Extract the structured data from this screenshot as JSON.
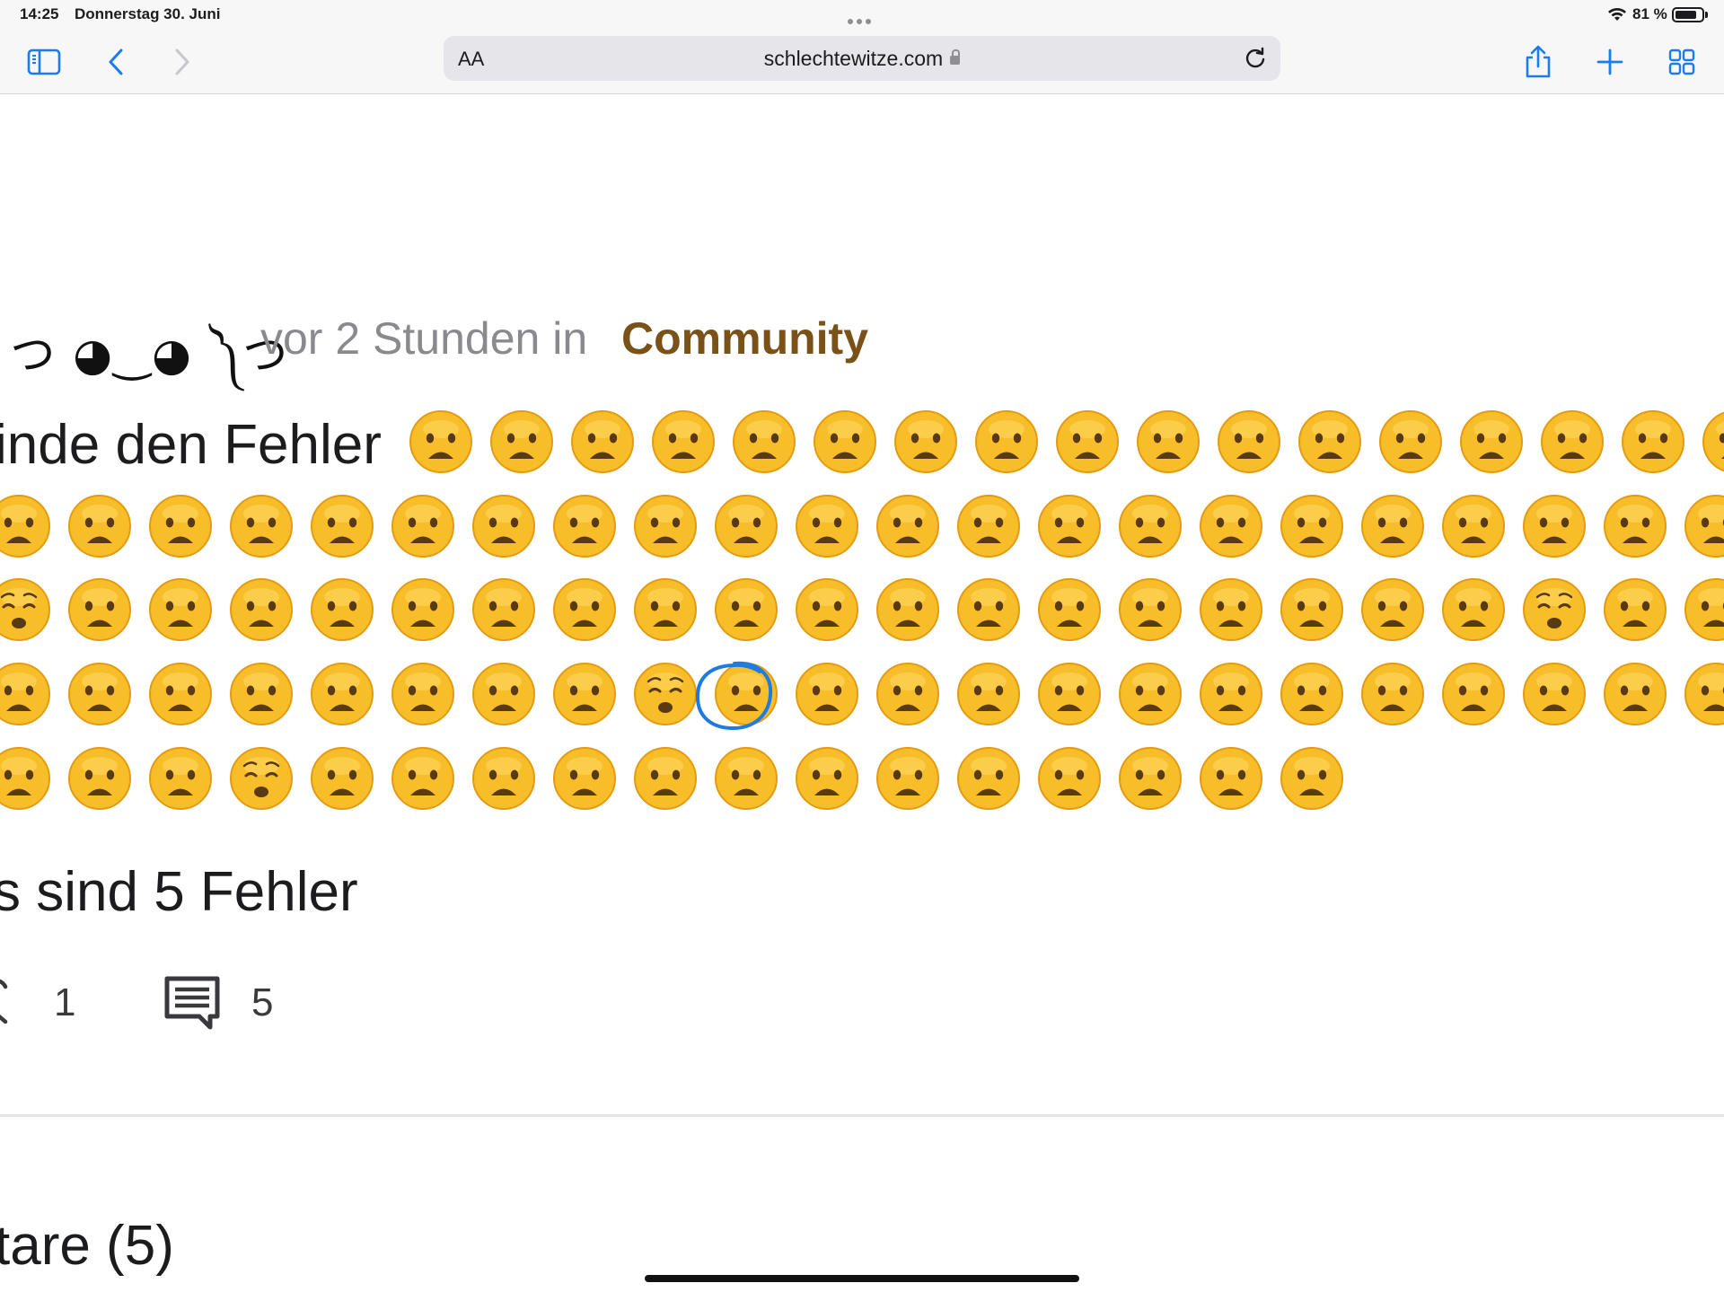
{
  "status_bar": {
    "time": "14:25",
    "date": "Donnerstag 30. Juni",
    "battery_percent": "81 %",
    "battery_level": 0.81
  },
  "toolbar": {
    "reader_label": "AA",
    "url": "schlechtewitze.com",
    "icons": [
      "sidebar-icon",
      "back-icon",
      "forward-icon",
      "reload-icon",
      "share-icon",
      "plus-icon",
      "tabs-grid-icon"
    ]
  },
  "post": {
    "author": "ʖ̯ つ ◕‿◕ ༽つ",
    "time": "vor 2 Stunden in",
    "category": "Community",
    "title": "inde den Fehler",
    "answer": "s sind 5 Fehler",
    "likes": "1",
    "comments": "5"
  },
  "comments_section": {
    "heading": "tare (5)"
  },
  "emoji_puzzle": {
    "rows": 5,
    "odd_emoji_positions": [
      {
        "row": 3,
        "col": 0
      },
      {
        "row": 3,
        "col": 19
      },
      {
        "row": 4,
        "col": 8
      },
      {
        "row": 5,
        "col": 3
      }
    ],
    "marked_position": {
      "row": 4,
      "col": 8
    },
    "colors": {
      "face": "#f7be2a",
      "face_edge": "#e39b12",
      "feature": "#5a3a12",
      "marker": "#1f7be0"
    }
  }
}
